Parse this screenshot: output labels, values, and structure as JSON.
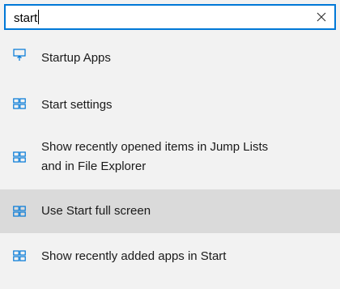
{
  "search": {
    "value": "start",
    "clear_label": "×"
  },
  "results": [
    {
      "icon": "monitor-upload-icon",
      "label": "Startup Apps",
      "selected": false
    },
    {
      "icon": "settings-panel-icon",
      "label": "Start settings",
      "selected": false
    },
    {
      "icon": "settings-panel-icon",
      "label_line1": "Show recently opened items in Jump Lists",
      "label_line2": "and in File Explorer",
      "selected": false
    },
    {
      "icon": "settings-panel-icon",
      "label": "Use Start full screen",
      "selected": true
    },
    {
      "icon": "settings-panel-icon",
      "label": "Show recently added apps in Start",
      "selected": false
    }
  ],
  "colors": {
    "accent": "#0078d7",
    "background": "#f2f2f2",
    "selected_row": "#dadada"
  }
}
